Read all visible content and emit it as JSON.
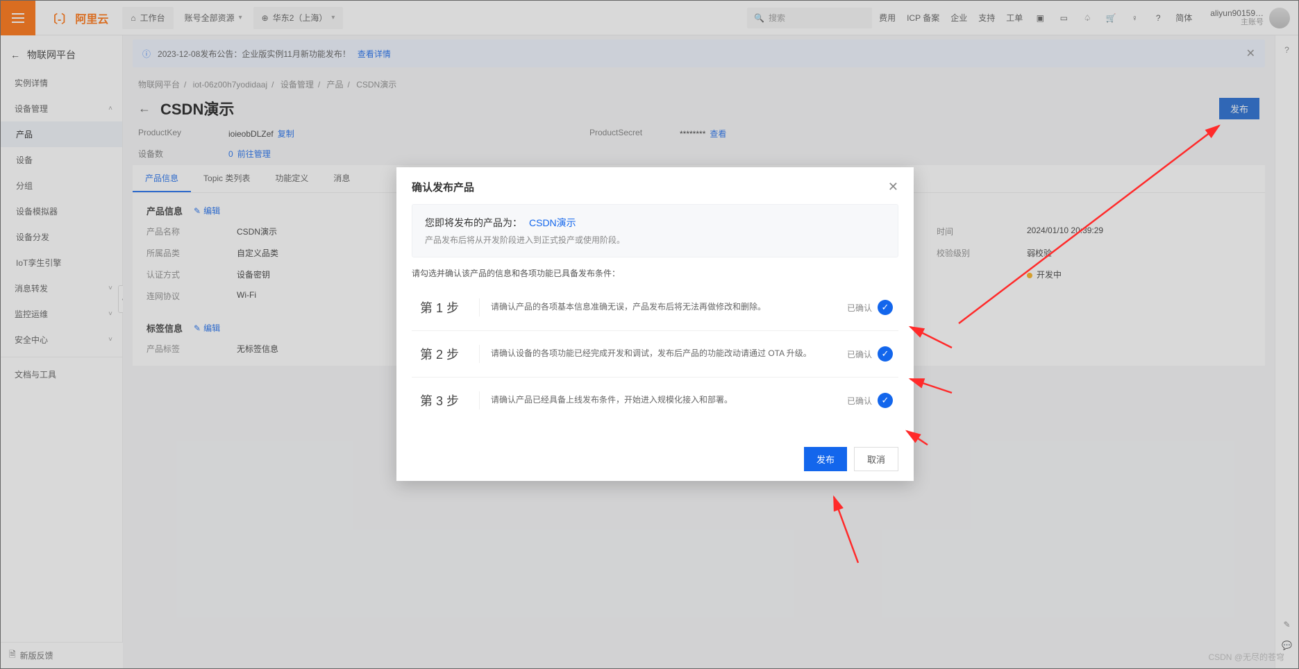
{
  "topbar": {
    "brand": "阿里云",
    "workbench": "工作台",
    "accountRes": "账号全部资源",
    "region": "华东2（上海）",
    "searchPlaceholder": "搜索",
    "links": [
      "费用",
      "ICP 备案",
      "企业",
      "支持",
      "工单"
    ],
    "lang": "简体",
    "user": "aliyun90159…",
    "userSub": "主账号"
  },
  "sidebar": {
    "title": "物联网平台",
    "items": [
      {
        "label": "实例详情"
      },
      {
        "label": "设备管理",
        "expand": true
      },
      {
        "label": "产品",
        "active": true,
        "sub": true
      },
      {
        "label": "设备",
        "sub": true
      },
      {
        "label": "分组",
        "sub": true
      },
      {
        "label": "设备模拟器",
        "sub": true
      },
      {
        "label": "设备分发",
        "sub": true
      },
      {
        "label": "IoT孪生引擎",
        "sub": true
      },
      {
        "label": "消息转发",
        "expand": false
      },
      {
        "label": "监控运维",
        "expand": false
      },
      {
        "label": "安全中心",
        "expand": false
      },
      {
        "label": "文档与工具"
      }
    ],
    "feedback": "新版反馈"
  },
  "banner": {
    "text": "2023-12-08发布公告：企业版实例11月新功能发布！",
    "link": "查看详情"
  },
  "crumbs": [
    "物联网平台",
    "iot-06z00h7yodidaaj",
    "设备管理",
    "产品",
    "CSDN演示"
  ],
  "page": {
    "title": "CSDN演示",
    "publish": "发布",
    "meta": {
      "keyLabel": "ProductKey",
      "keyValue": "ioieobDLZef",
      "copy": "复制",
      "secretLabel": "ProductSecret",
      "secretValue": "********",
      "view": "查看",
      "devNumLabel": "设备数",
      "devNumValue": "0",
      "manage": "前往管理"
    }
  },
  "tabs": [
    "产品信息",
    "Topic 类列表",
    "功能定义",
    "消息"
  ],
  "info": {
    "sect1": "产品信息",
    "edit": "编辑",
    "rows": [
      {
        "k": "产品名称",
        "v": "CSDN演示",
        "k2": "时间",
        "v2": "2024/01/10 20:39:29"
      },
      {
        "k": "所属品类",
        "v": "自定义品类",
        "k2": "校验级别",
        "v2": "弱校验"
      },
      {
        "k": "认证方式",
        "v": "设备密钥",
        "k2": "",
        "v2": "",
        "status": "开发中"
      },
      {
        "k": "连网协议",
        "v": "Wi-Fi"
      }
    ],
    "sect2": "标签信息",
    "tagKey": "产品标签",
    "tagVal": "无标签信息"
  },
  "modal": {
    "title": "确认发布产品",
    "productPrefix": "您即将发布的产品为：",
    "productName": "CSDN演示",
    "productHint": "产品发布后将从开发阶段进入到正式投产或使用阶段。",
    "checkHint": "请勾选并确认该产品的信息和各项功能已具备发布条件：",
    "confirmed": "已确认",
    "steps": [
      {
        "no": "第 1 步",
        "desc": "请确认产品的各项基本信息准确无误，产品发布后将无法再做修改和删除。"
      },
      {
        "no": "第 2 步",
        "desc": "请确认设备的各项功能已经完成开发和调试，发布后产品的功能改动请通过 OTA 升级。"
      },
      {
        "no": "第 3 步",
        "desc": "请确认产品已经具备上线发布条件，开始进入规模化接入和部署。"
      }
    ],
    "ok": "发布",
    "cancel": "取消"
  },
  "watermark": "CSDN @无尽的苍穹"
}
